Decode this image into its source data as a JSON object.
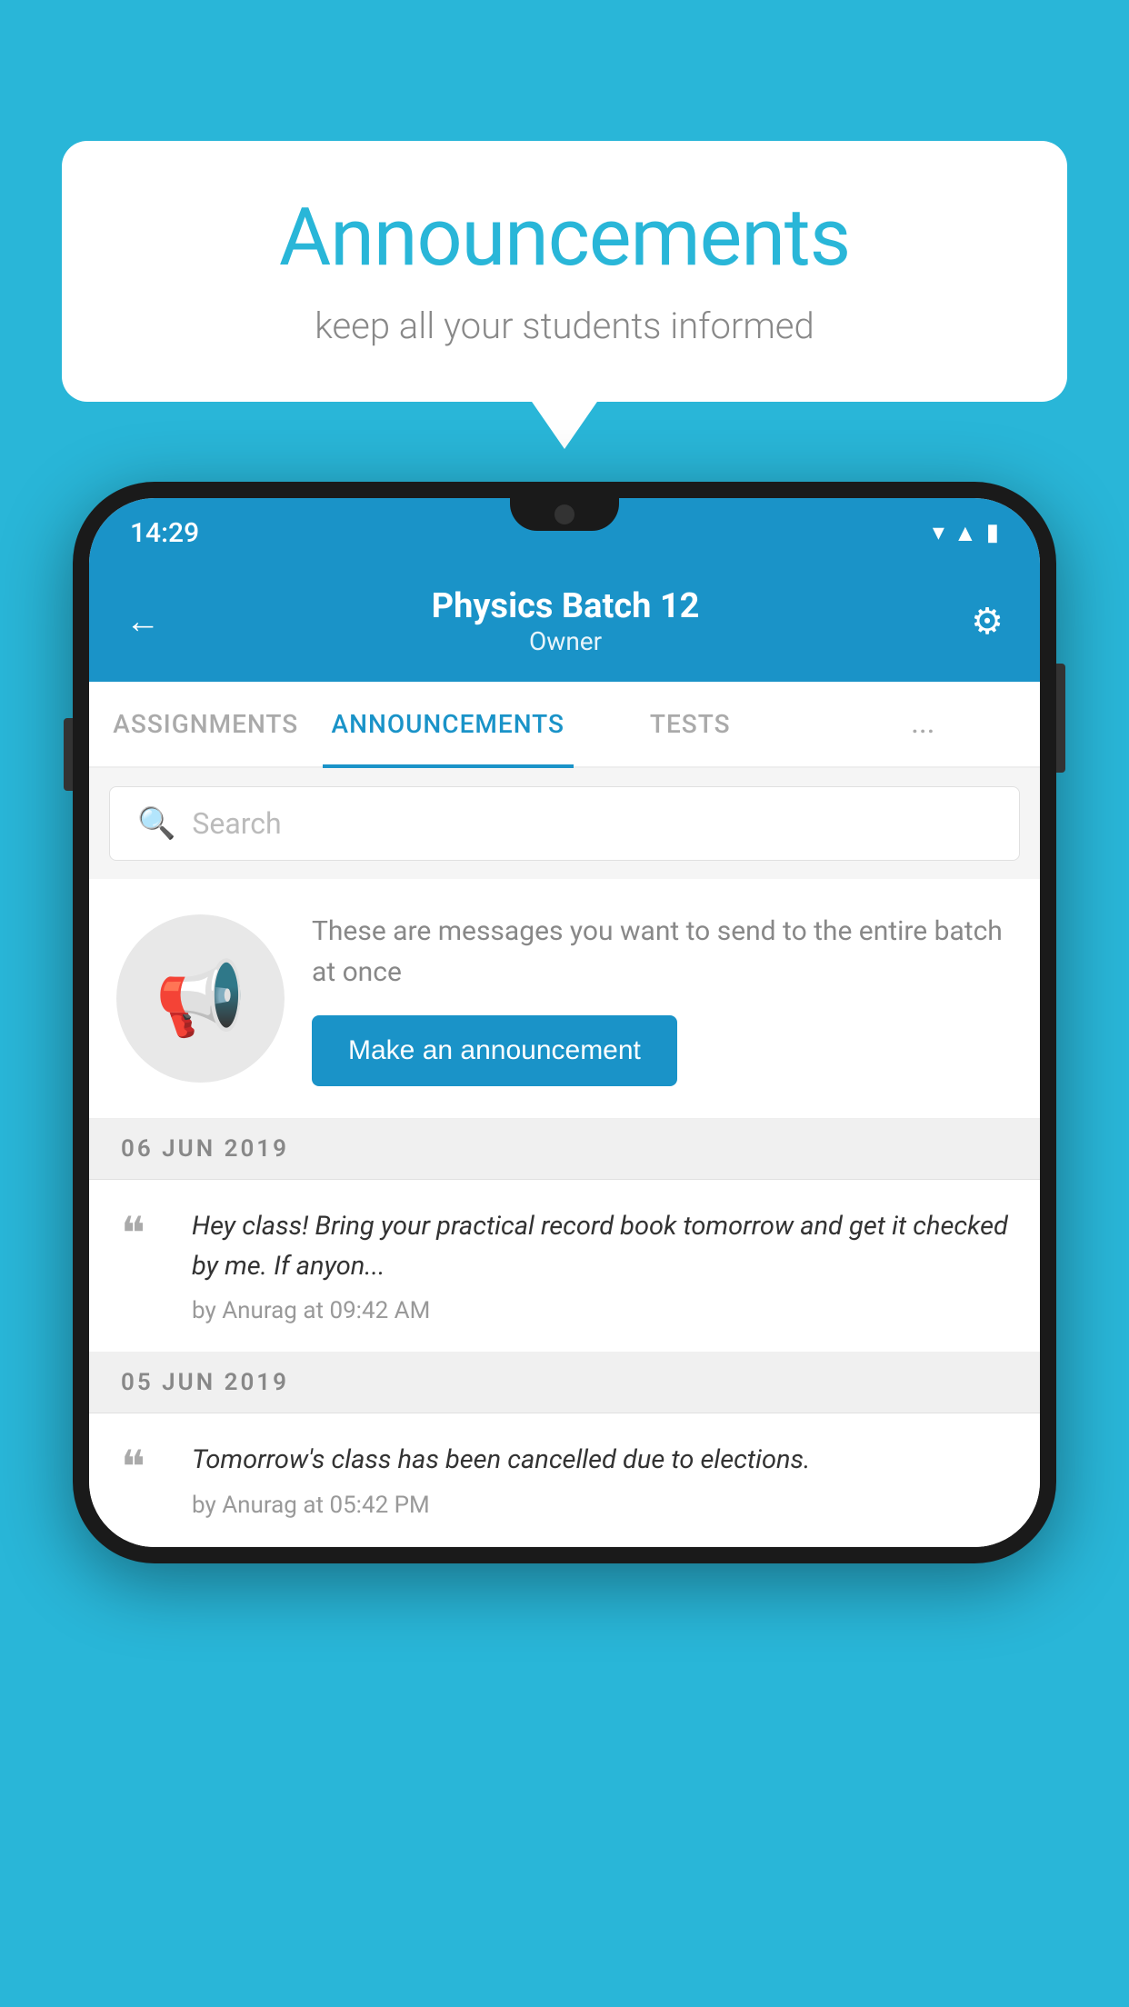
{
  "background_color": "#29b6d8",
  "speech_bubble": {
    "title": "Announcements",
    "subtitle": "keep all your students informed"
  },
  "phone": {
    "status_bar": {
      "time": "14:29",
      "wifi_icon": "▾",
      "signal_icon": "▲",
      "battery_icon": "▮"
    },
    "header": {
      "back_label": "←",
      "title": "Physics Batch 12",
      "subtitle": "Owner",
      "gear_label": "⚙"
    },
    "tabs": [
      {
        "label": "ASSIGNMENTS",
        "active": false
      },
      {
        "label": "ANNOUNCEMENTS",
        "active": true
      },
      {
        "label": "TESTS",
        "active": false
      },
      {
        "label": "...",
        "active": false
      }
    ],
    "search": {
      "placeholder": "Search"
    },
    "announcement_prompt": {
      "description": "These are messages you want to send to the entire batch at once",
      "button_label": "Make an announcement"
    },
    "announcements": [
      {
        "date": "06  JUN  2019",
        "text": "Hey class! Bring your practical record book tomorrow and get it checked by me. If anyon...",
        "meta": "by Anurag at 09:42 AM"
      },
      {
        "date": "05  JUN  2019",
        "text": "Tomorrow's class has been cancelled due to elections.",
        "meta": "by Anurag at 05:42 PM"
      }
    ]
  }
}
